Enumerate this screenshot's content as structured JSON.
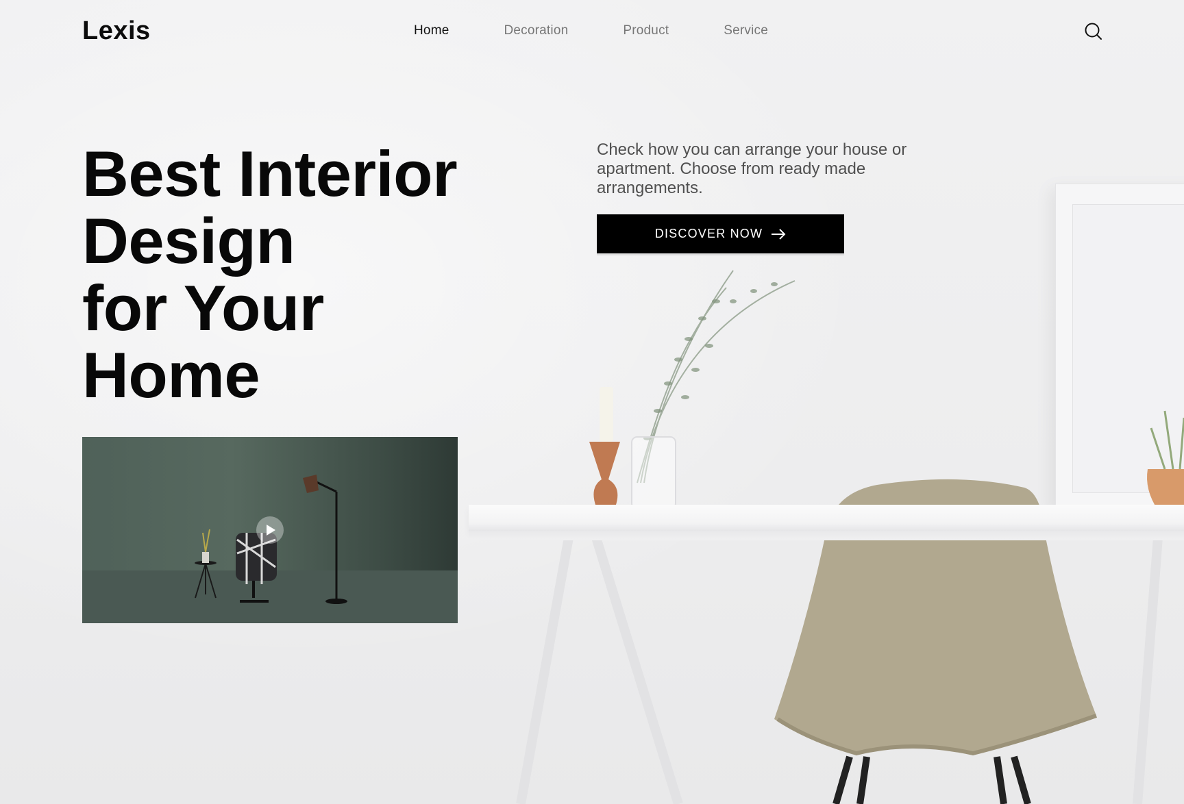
{
  "brand": {
    "logo_text": "Lexis"
  },
  "nav": {
    "items": [
      {
        "label": "Home",
        "active": true
      },
      {
        "label": "Decoration",
        "active": false
      },
      {
        "label": "Product",
        "active": false
      },
      {
        "label": "Service",
        "active": false
      }
    ],
    "search_icon": "search-icon"
  },
  "hero": {
    "title_lines": [
      "Best Interior",
      "Design",
      "for Your",
      "Home"
    ],
    "description": "Check how you can arrange your house or apartment. Choose from ready made arrangements.",
    "cta_label": "DISCOVER NOW",
    "cta_icon": "arrow-right-icon"
  },
  "video": {
    "play_icon": "play-icon"
  },
  "colors": {
    "accent": "#000000",
    "background": "#efeff0",
    "nav_inactive": "#777777",
    "video_bg": "#4f6159",
    "chair": "#b1a88f"
  }
}
